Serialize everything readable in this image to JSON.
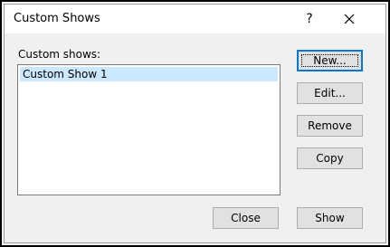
{
  "dialog": {
    "title": "Custom Shows",
    "help_label": "?"
  },
  "list": {
    "label": "Custom shows:",
    "items": [
      "Custom Show 1"
    ],
    "selected_index": 0
  },
  "buttons": {
    "new_label": "New...",
    "edit_label": "Edit...",
    "remove_label": "Remove",
    "copy_label": "Copy",
    "close_label": "Close",
    "show_label": "Show"
  },
  "colors": {
    "selection": "#cce8ff",
    "default_button_border": "#0078d7",
    "button_face": "#e1e1e1",
    "dialog_background": "#f0f0f0"
  },
  "icons": {
    "close": "close-icon",
    "help": "help-icon"
  }
}
